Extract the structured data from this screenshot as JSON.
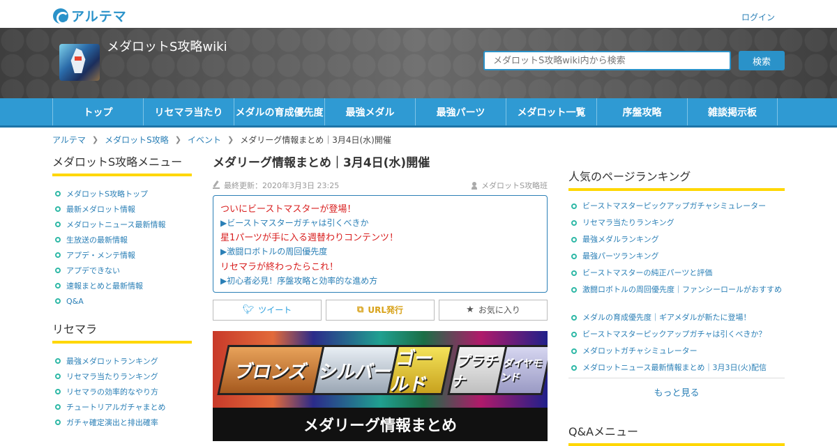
{
  "brand": {
    "logo_text": "アルテマ",
    "login": "ログイン"
  },
  "header": {
    "site_title": "メダロットS攻略wiki",
    "search_placeholder": "メダロットS攻略wiki内から検索",
    "search_button": "検索"
  },
  "nav": [
    "トップ",
    "リセマラ当たり",
    "メダルの育成優先度",
    "最強メダル",
    "最強パーツ",
    "メダロット一覧",
    "序盤攻略",
    "雑談掲示板"
  ],
  "breadcrumb": [
    "アルテマ",
    "メダロットS攻略",
    "イベント",
    "メダリーグ情報まとめ｜3月4日(水)開催"
  ],
  "left_sidebar": {
    "menu_heading": "メダロットS攻略メニュー",
    "menu_items": [
      "メダロットS攻略トップ",
      "最新メダロット情報",
      "メダロットニュース最新情報",
      "生放送の最新情報",
      "アプデ・メンテ情報",
      "アプデできない",
      "速報まとめと最新情報",
      "Q&A"
    ],
    "risemara_heading": "リセマラ",
    "risemara_items": [
      "最強メダロットランキング",
      "リセマラ当たりランキング",
      "リセマラの効率的なやり方",
      "チュートリアルガチャまとめ",
      "ガチャ確定演出と排出確率"
    ]
  },
  "article": {
    "title": "メダリーグ情報まとめ｜3月4日(水)開催",
    "updated": "最終更新：2020年3月3日 23:25",
    "author": "メダロットS攻略班",
    "promo": [
      {
        "text": "ついにビーストマスターが登場！",
        "style": "red"
      },
      {
        "text": "▶ビーストマスターガチャは引くべきか",
        "style": "blue"
      },
      {
        "text": "星1パーツが手に入る週替わりコンテンツ！",
        "style": "red"
      },
      {
        "text": "▶激闘ロボトルの周回優先度",
        "style": "blue"
      },
      {
        "text": "リセマラが終わったらこれ！",
        "style": "red"
      },
      {
        "text": "▶初心者必見！序盤攻略と効率的な進め方",
        "style": "blue"
      }
    ],
    "share": {
      "tweet": "ツイート",
      "url": "URL発行",
      "favorite": "お気に入り"
    },
    "banner": {
      "leagues": [
        "ブロンズ",
        "シルバー",
        "ゴールド",
        "プラチナ",
        "ダイヤモンド"
      ],
      "caption": "メダリーグ情報まとめ"
    }
  },
  "right_sidebar": {
    "ranking_heading": "人気のページランキング",
    "ranking_items": [
      "ビーストマスターピックアップガチャシミュレーター",
      "リセマラ当たりランキング",
      "最強メダルランキング",
      "最強パーツランキング",
      "ビーストマスターの純正パーツと評価",
      "激闘ロボトルの周回優先度｜ファンシーロールがおすすめ",
      "メダルの育成優先度｜ギアメダルが新たに登場！",
      "ビーストマスターピックアップガチャは引くべきか？",
      "メダロットガチャシミュレーター",
      "メダロットニュース最新情報まとめ｜3月3日(火)配信"
    ],
    "more": "もっと見る",
    "qa_heading": "Q&Aメニュー"
  },
  "colors": {
    "accent": "#2f9ad3",
    "link": "#2a7fb6",
    "highlight": "#ffd700",
    "promo_red": "#d81e1e"
  }
}
